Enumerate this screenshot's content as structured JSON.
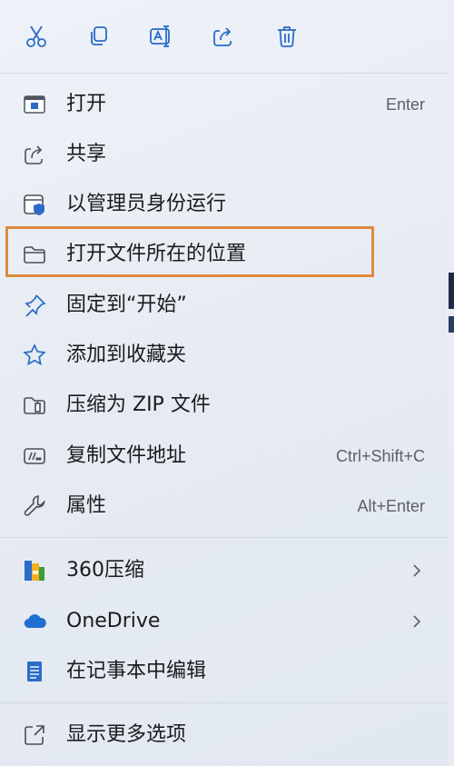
{
  "toolbar": {
    "buttons": [
      {
        "icon": "cut-icon"
      },
      {
        "icon": "copy-icon"
      },
      {
        "icon": "rename-icon"
      },
      {
        "icon": "share-icon"
      },
      {
        "icon": "delete-icon"
      }
    ]
  },
  "menu": {
    "items": [
      {
        "label": "打开",
        "shortcut": "Enter",
        "icon": "open-app-icon"
      },
      {
        "label": "共享",
        "icon": "share-icon"
      },
      {
        "label": "以管理员身份运行",
        "icon": "admin-shield-icon"
      },
      {
        "label": "打开文件所在的位置",
        "icon": "folder-icon",
        "highlighted": true
      },
      {
        "label": "固定到“开始”",
        "icon": "pin-icon"
      },
      {
        "label": "添加到收藏夹",
        "icon": "star-icon"
      },
      {
        "label": "压缩为 ZIP 文件",
        "icon": "zip-folder-icon"
      },
      {
        "label": "复制文件地址",
        "shortcut": "Ctrl+Shift+C",
        "icon": "copy-path-icon"
      },
      {
        "label": "属性",
        "shortcut": "Alt+Enter",
        "icon": "wrench-icon"
      },
      {
        "label": "360压缩",
        "icon": "360zip-icon",
        "submenu": true
      },
      {
        "label": "OneDrive",
        "icon": "onedrive-cloud-icon",
        "submenu": true
      },
      {
        "label": "在记事本中编辑",
        "icon": "notepad-icon"
      },
      {
        "label": "显示更多选项",
        "icon": "more-options-icon"
      }
    ]
  },
  "colors": {
    "icon_blue": "#2a6cc8",
    "highlight_border": "#de8a3c"
  }
}
